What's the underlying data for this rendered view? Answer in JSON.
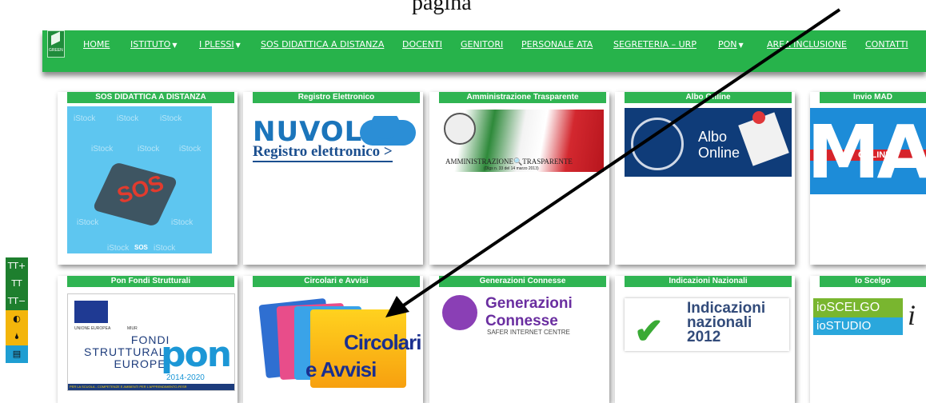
{
  "top_caption": "pagina",
  "nav": {
    "logo_text": "GREEN",
    "items": [
      {
        "label": "HOME",
        "caret": ""
      },
      {
        "label": "ISTITUTO",
        "caret": "▼"
      },
      {
        "label": "I PLESSI",
        "caret": "▼"
      },
      {
        "label": "SOS DIDATTICA A DISTANZA",
        "caret": ""
      },
      {
        "label": "DOCENTI",
        "caret": ""
      },
      {
        "label": "GENITORI",
        "caret": ""
      },
      {
        "label": "PERSONALE ATA",
        "caret": ""
      },
      {
        "label": "SEGRETERIA – URP",
        "caret": ""
      },
      {
        "label": "PON",
        "caret": "▼"
      },
      {
        "label": "AREA INCLUSIONE",
        "caret": ""
      },
      {
        "label": "CONTATTI",
        "caret": ""
      }
    ]
  },
  "cards": [
    {
      "title": "SOS DIDATTICA A DISTANZA",
      "image": {
        "big": "SOS",
        "watermark": "iStock",
        "small": "SOS"
      }
    },
    {
      "title": "Registro Elettronico",
      "image": {
        "line1": "NUVOLA",
        "line2": "Registro elettronico >"
      }
    },
    {
      "title": "Amministrazione Trasparente",
      "image": {
        "line1": "AMMINISTRAZIONE",
        "line1b": "TRASPARENTE",
        "line2": "(Dlgs n. 33 del 14 marzo 2013)"
      }
    },
    {
      "title": "Albo Online",
      "image": {
        "line1": "Albo",
        "line2": "Online"
      }
    },
    {
      "title": "Invio MAD",
      "image": {
        "big": "MAD",
        "band": "ONLINE"
      }
    },
    {
      "title": "Pon Fondi Strutturali",
      "image": {
        "eu": "UNIONE EUROPEA",
        "miur": "MIUR",
        "fondi1": "FONDI",
        "fondi2": "STRUTTURALI",
        "fondi3": "EUROPEI",
        "pon": "PON",
        "years": "2014-2020",
        "footer": "PER LA SCUOLA - COMPETENZE E AMBIENTI PER L'APPRENDIMENTO-FESR"
      }
    },
    {
      "title": "Circolari e Avvisi",
      "image": {
        "line1": "Circolari",
        "line2": "e Avvisi"
      }
    },
    {
      "title": "Generazioni Connesse",
      "image": {
        "line1": "Generazioni",
        "line2": "Connesse",
        "line3": "SAFER INTERNET CENTRE"
      }
    },
    {
      "title": "Indicazioni Nazionali",
      "image": {
        "line1": "Indicazioni",
        "line2": "nazionali",
        "line3": "2012"
      }
    },
    {
      "title": "Io Scelgo",
      "image": {
        "line1": "ioSCELGO",
        "line2": "ioSTUDIO",
        "line3": "i"
      }
    }
  ],
  "accessibility": [
    {
      "label": "TT+",
      "icon": "text-increase-icon",
      "color": "#1e7f2e"
    },
    {
      "label": "TT",
      "icon": "text-reset-icon",
      "color": "#1e7f2e"
    },
    {
      "label": "TT−",
      "icon": "text-decrease-icon",
      "color": "#1e7f2e"
    },
    {
      "label": "◐",
      "icon": "contrast-icon",
      "color": "#f3b50b"
    },
    {
      "label": "🌢",
      "icon": "grayscale-icon",
      "color": "#f3b50b"
    },
    {
      "label": "▤",
      "icon": "readable-font-icon",
      "color": "#1f9ed2"
    }
  ],
  "colors": {
    "nav_bg": "#27b34b",
    "card_caption": "#2fb452",
    "arrow": "#000000"
  }
}
